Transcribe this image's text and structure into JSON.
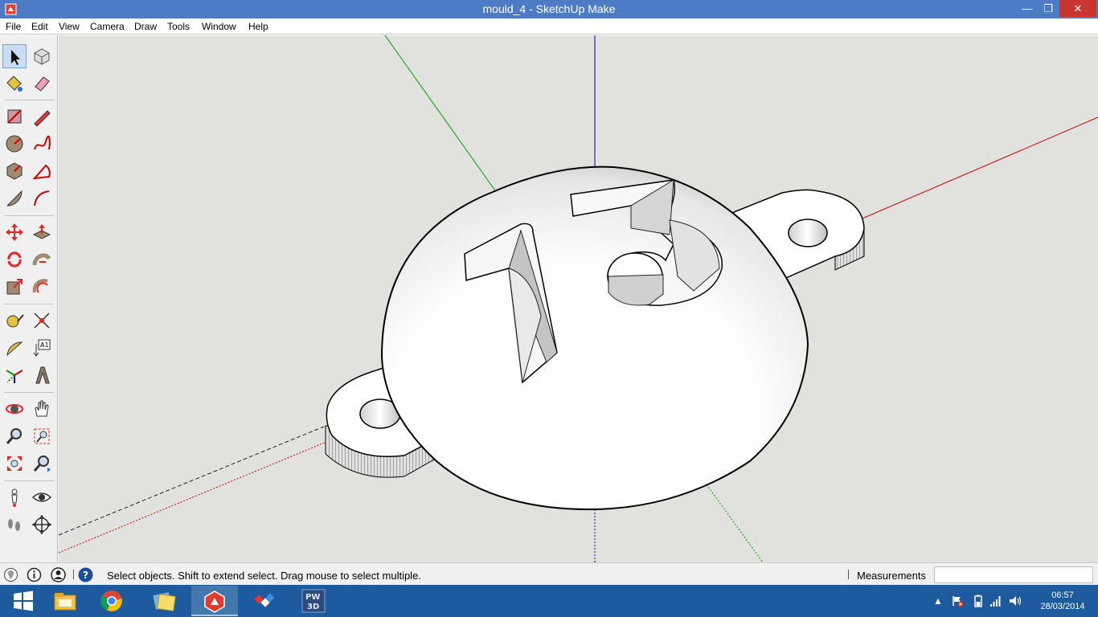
{
  "window": {
    "title": "mould_4 - SketchUp Make"
  },
  "menu": [
    "File",
    "Edit",
    "View",
    "Camera",
    "Draw",
    "Tools",
    "Window",
    "Help"
  ],
  "toolbar": {
    "tools": [
      "select-tool-icon",
      "component-tool-icon",
      "paint-bucket-icon",
      "eraser-icon",
      "rectangle-tool-icon",
      "pencil-line-icon",
      "circle-tool-icon",
      "freehand-tool-icon",
      "polygon-tool-icon",
      "pie-tool-icon",
      "arc-tool-icon",
      "two-point-arc-icon",
      "move-tool-icon",
      "push-pull-icon",
      "rotate-tool-icon",
      "follow-me-icon",
      "scale-tool-icon",
      "offset-tool-icon",
      "tape-measure-icon",
      "dimension-tool-icon",
      "protractor-icon",
      "text-tool-icon",
      "axes-tool-icon",
      "3d-text-icon",
      "orbit-tool-icon",
      "pan-tool-icon",
      "zoom-tool-icon",
      "zoom-window-icon",
      "zoom-extents-icon",
      "previous-view-icon",
      "position-camera-icon",
      "look-around-icon",
      "walk-tool-icon",
      "section-plane-icon"
    ]
  },
  "model": {
    "engraved_text": "73"
  },
  "status": {
    "hint": "Select objects. Shift to extend select. Drag mouse to select multiple.",
    "measurements_label": "Measurements",
    "measurements_value": ""
  },
  "taskbar": {
    "apps": [
      "windows-start-icon",
      "file-explorer-icon",
      "chrome-icon",
      "photos-icon",
      "sketchup-icon",
      "app-icon",
      "pw3d-icon"
    ],
    "pw3d_label": "PW 3D",
    "time": "06:57",
    "date": "28/03/2014"
  },
  "colors": {
    "titlebar": "#4d7bc6",
    "viewport_bg": "#e1e1de",
    "taskbar": "#1d5a9e",
    "axis_red": "#cc0000",
    "axis_green": "#00a000",
    "axis_blue": "#0000cc"
  }
}
